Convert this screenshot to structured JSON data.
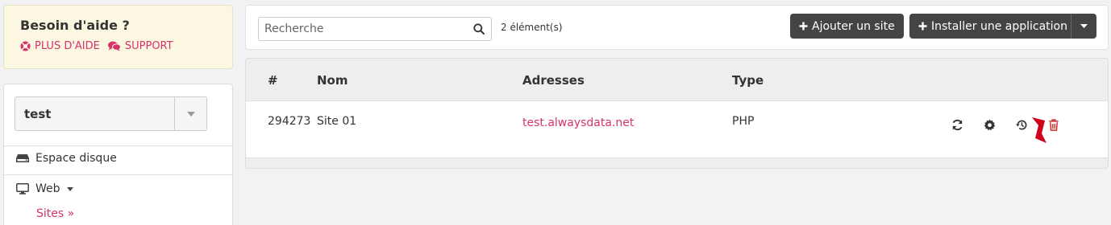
{
  "help": {
    "title": "Besoin d'aide ?",
    "more_help": "PLUS D'AIDE",
    "support": "SUPPORT"
  },
  "account": {
    "selected": "test"
  },
  "nav": {
    "disk": "Espace disque",
    "web": "Web",
    "sites": "Sites »"
  },
  "toolbar": {
    "search_placeholder": "Recherche",
    "count": "2 élément(s)",
    "add_site": "Ajouter un site",
    "install_app": "Installer une application"
  },
  "table": {
    "headers": [
      "#",
      "Nom",
      "Adresses",
      "Type"
    ],
    "rows": [
      {
        "id": "294273",
        "name": "Site 01",
        "address": "test.alwaysdata.net",
        "type": "PHP"
      }
    ],
    "actions": [
      "refresh-icon",
      "gear-icon",
      "history-icon",
      "trash-icon"
    ]
  },
  "colors": {
    "accent": "#d6336c",
    "button_dark": "#444444",
    "help_bg": "#fbf7e0",
    "delete_red": "#c9302c"
  }
}
